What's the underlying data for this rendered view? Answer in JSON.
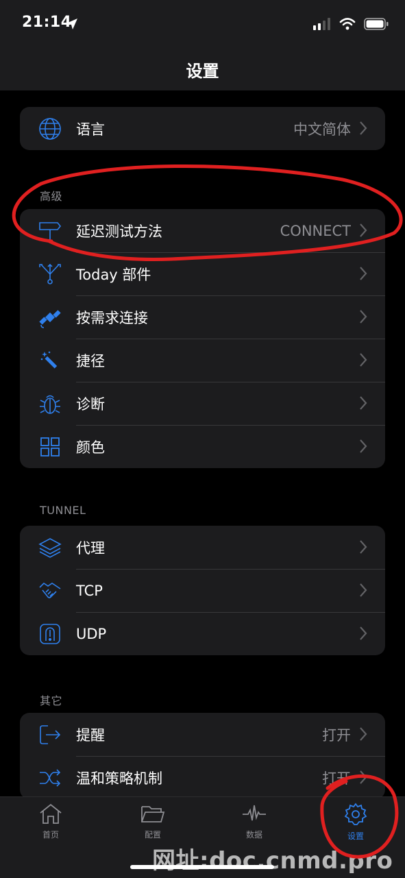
{
  "status_bar": {
    "time": "21:14"
  },
  "nav": {
    "title": "设置"
  },
  "sections": {
    "general": {
      "language_label": "语言",
      "language_value": "中文简体"
    },
    "advanced": {
      "header": "高级",
      "items": [
        {
          "label": "延迟测试方法",
          "value": "CONNECT"
        },
        {
          "label": "Today 部件",
          "value": ""
        },
        {
          "label": "按需求连接",
          "value": ""
        },
        {
          "label": "捷径",
          "value": ""
        },
        {
          "label": "诊断",
          "value": ""
        },
        {
          "label": "颜色",
          "value": ""
        }
      ]
    },
    "tunnel": {
      "header": "TUNNEL",
      "items": [
        {
          "label": "代理"
        },
        {
          "label": "TCP"
        },
        {
          "label": "UDP"
        }
      ]
    },
    "other": {
      "header": "其它",
      "items": [
        {
          "label": "提醒",
          "value": "打开"
        },
        {
          "label": "温和策略机制",
          "value": "打开"
        }
      ]
    }
  },
  "tabbar": {
    "tabs": [
      {
        "label": "首页",
        "icon": "home-icon"
      },
      {
        "label": "配置",
        "icon": "folder-icon"
      },
      {
        "label": "数据",
        "icon": "activity-icon"
      },
      {
        "label": "设置",
        "icon": "gear-icon",
        "active": true
      }
    ]
  },
  "watermark": "网址:doc.cnmd.pro",
  "colors": {
    "accent": "#2f80ed",
    "annotation": "#e02020",
    "card": "#1c1c1e",
    "background": "#000000"
  }
}
